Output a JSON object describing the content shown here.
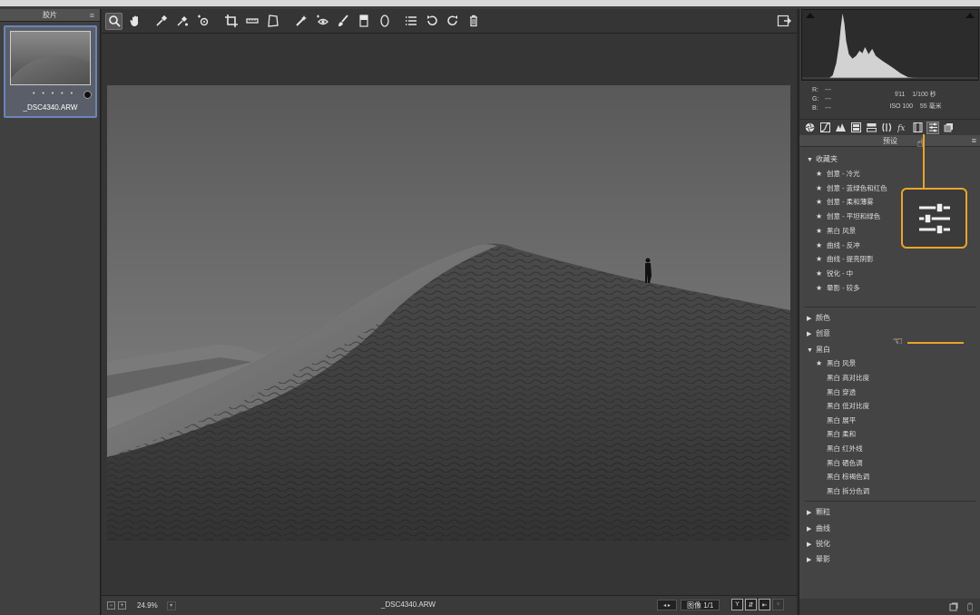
{
  "filmstrip": {
    "title": "胶片",
    "thumbnail": {
      "name": "_DSC4340.ARW",
      "stars": "• • • • •"
    }
  },
  "toolbar": {
    "tools": [
      {
        "id": "zoom",
        "icon": "zoom-icon",
        "active": true
      },
      {
        "id": "hand",
        "icon": "hand-icon"
      },
      {
        "id": "white-balance",
        "icon": "eyedropper-icon"
      },
      {
        "id": "color-sampler",
        "icon": "color-sampler-icon"
      },
      {
        "id": "targeted-adjustment",
        "icon": "targeted-adjustment-icon"
      },
      {
        "id": "crop",
        "icon": "crop-icon"
      },
      {
        "id": "straighten",
        "icon": "straighten-icon"
      },
      {
        "id": "transform",
        "icon": "transform-icon"
      },
      {
        "id": "spot-removal",
        "icon": "spot-removal-icon"
      },
      {
        "id": "red-eye",
        "icon": "red-eye-icon"
      },
      {
        "id": "adjustment-brush",
        "icon": "brush-icon"
      },
      {
        "id": "graduated-filter",
        "icon": "graduated-filter-icon"
      },
      {
        "id": "radial-filter",
        "icon": "radial-filter-icon"
      },
      {
        "id": "preferences",
        "icon": "list-icon"
      },
      {
        "id": "rotate-left",
        "icon": "rotate-left-icon"
      },
      {
        "id": "rotate-right",
        "icon": "rotate-right-icon"
      },
      {
        "id": "trash",
        "icon": "trash-icon"
      }
    ]
  },
  "statusbar": {
    "zoom": "24.9%",
    "filename": "_DSC4340.ARW",
    "image_counter": "图像 1/1"
  },
  "info": {
    "r_label": "R:",
    "g_label": "G:",
    "b_label": "B:",
    "r": "---",
    "g": "---",
    "b": "---",
    "aperture": "f/11",
    "shutter": "1/100 秒",
    "iso": "ISO 100",
    "focal": "55 毫米"
  },
  "presets": {
    "header": "预设",
    "favorites": {
      "label": "收藏夹",
      "items": [
        "创意 - 冷光",
        "创意 - 蓝绿色和红色",
        "创意 - 柔和薄雾",
        "创意 - 平坦和绿色",
        "黑白 风景",
        "曲线 - 反冲",
        "曲线 - 提亮阴影",
        "锐化 - 中",
        "晕影 - 较多"
      ]
    },
    "color": "颜色",
    "creative": "创意",
    "bw": {
      "label": "黑白",
      "starred": "黑白 风景",
      "items": [
        "黑白 高对比度",
        "黑白 穿透",
        "黑白 低对比度",
        "黑白 展平",
        "黑白 柔和",
        "黑白 红外线",
        "黑白 硒色调",
        "黑白 棕褐色调",
        "黑白 拆分色调"
      ]
    },
    "grain": "颗粒",
    "curve": "曲线",
    "sharpen": "锐化",
    "vignette": "晕影"
  },
  "colors": {
    "accent": "#e8a52a",
    "selection": "#6c84b8"
  }
}
